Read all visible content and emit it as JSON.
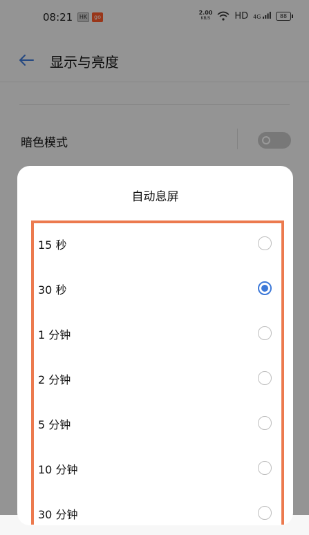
{
  "statusbar": {
    "time": "08:21",
    "notif_a": "HK",
    "notif_b": "go",
    "net_speed_value": "2.00",
    "net_speed_unit": "KB/S",
    "hd": "HD",
    "signal": "4G",
    "battery": "88"
  },
  "header": {
    "title": "显示与亮度"
  },
  "dark_mode": {
    "label": "暗色模式",
    "enabled": false
  },
  "sheet": {
    "title": "自动息屏",
    "selected_index": 1,
    "options": [
      {
        "label": "15 秒"
      },
      {
        "label": "30 秒"
      },
      {
        "label": "1 分钟"
      },
      {
        "label": "2 分钟"
      },
      {
        "label": "5 分钟"
      },
      {
        "label": "10 分钟"
      },
      {
        "label": "30 分钟"
      }
    ]
  },
  "colors": {
    "accent": "#3c78d8",
    "highlight_border": "#ec7a4e"
  }
}
